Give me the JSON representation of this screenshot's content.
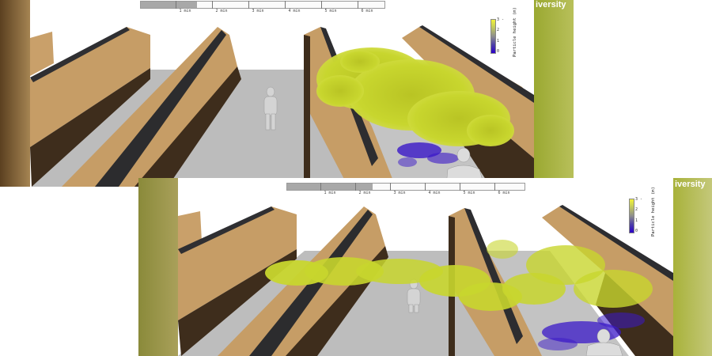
{
  "frames": [
    {
      "timeline": {
        "progress_fraction": 0.23,
        "tick_labels": [
          "1 min",
          "2 min",
          "3 min",
          "4 min",
          "5 min",
          "6 min"
        ]
      },
      "colorbar": {
        "title": "Particle height (m)",
        "tick_labels": [
          "3 -",
          "2",
          "1",
          "0"
        ]
      },
      "brand_text": "iversity"
    },
    {
      "timeline": {
        "progress_fraction": 0.36,
        "tick_labels": [
          "1 min",
          "2 min",
          "3 min",
          "4 min",
          "5 min",
          "6 min"
        ]
      },
      "colorbar": {
        "title": "Particle height (m)",
        "tick_labels": [
          "3 -",
          "2",
          "1",
          "0"
        ]
      },
      "brand_text": "iversity"
    }
  ],
  "colors": {
    "partition_wood": "#c9a06a",
    "partition_dark": "#3c2c1c",
    "floor": "#bdbdbd",
    "particles_high": "#c8d628",
    "particles_low": "#3a18c8",
    "brand_panel": "#a8b23a"
  }
}
